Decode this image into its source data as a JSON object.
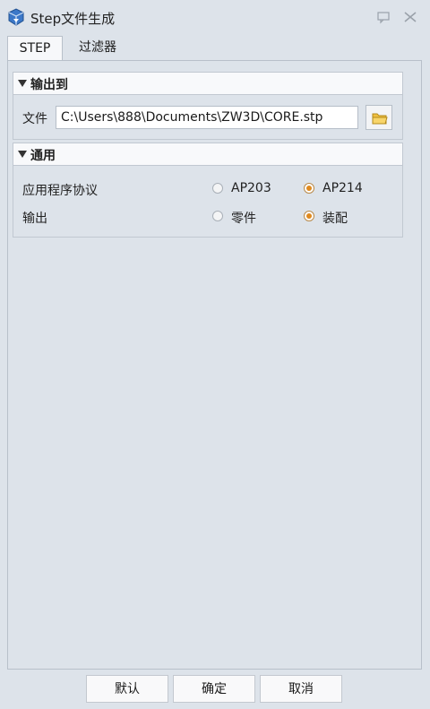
{
  "window": {
    "title": "Step文件生成"
  },
  "tabs": [
    {
      "label": "STEP",
      "active": true
    },
    {
      "label": "过滤器",
      "active": false
    }
  ],
  "output_group": {
    "title": "输出到",
    "file_label": "文件",
    "file_value": "C:\\Users\\888\\Documents\\ZW3D\\CORE.stp"
  },
  "general_group": {
    "title": "通用",
    "protocol": {
      "label": "应用程序协议",
      "options": [
        "AP203",
        "AP214"
      ],
      "selected": "AP214"
    },
    "output": {
      "label": "输出",
      "options": [
        "零件",
        "装配"
      ],
      "selected": "装配"
    }
  },
  "buttons": {
    "default": "默认",
    "ok": "确定",
    "cancel": "取消"
  },
  "colors": {
    "radio_selected": "#e08a1e",
    "background": "#dde3ea"
  },
  "icons": {
    "app": "app-icon",
    "chat": "chat-icon",
    "close": "close-icon",
    "folder": "folder-icon"
  }
}
